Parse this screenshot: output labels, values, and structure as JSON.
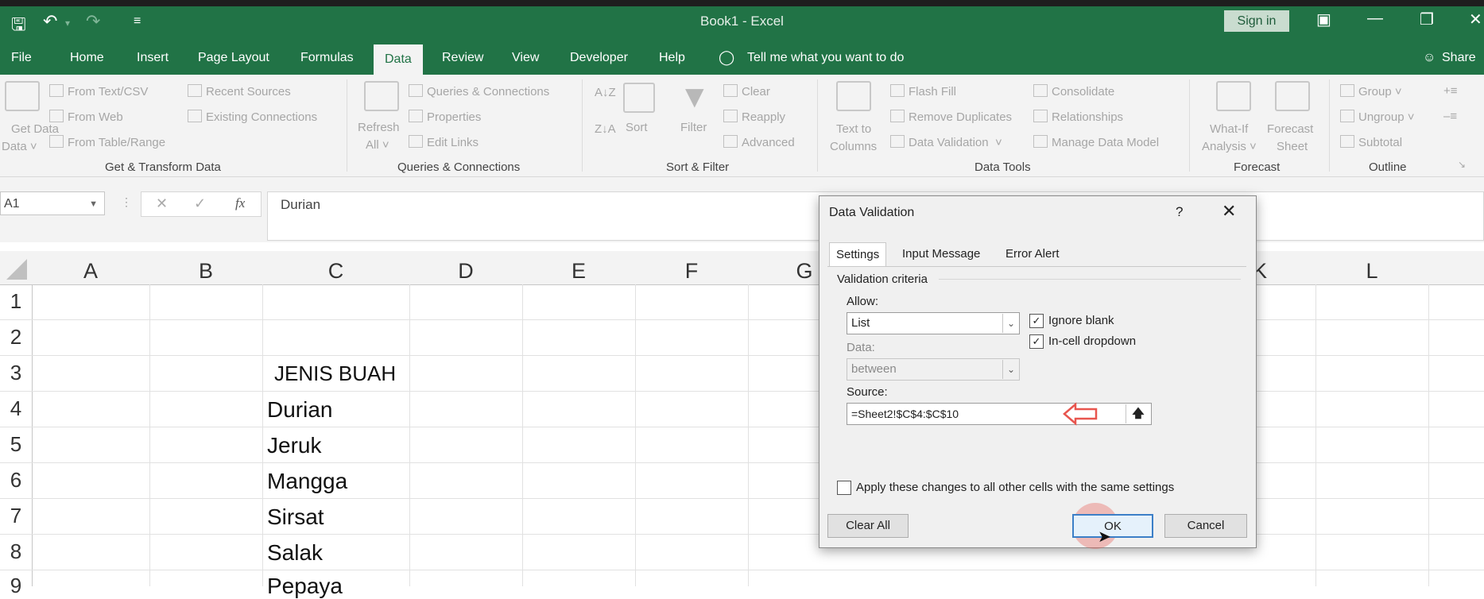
{
  "window": {
    "title": "Book1  -  Excel",
    "sign_in": "Sign in",
    "share": "Share"
  },
  "tabs": [
    "File",
    "Home",
    "Insert",
    "Page Layout",
    "Formulas",
    "Data",
    "Review",
    "View",
    "Developer",
    "Help"
  ],
  "tell_me": "Tell me what you want to do",
  "ribbon": {
    "get_data": "Get Data",
    "get_data_arrow": "Data ˅",
    "from_text_csv": "From Text/CSV",
    "from_web": "From Web",
    "from_table_range": "From Table/Range",
    "recent_sources": "Recent Sources",
    "existing_connections": "Existing Connections",
    "group_get_transform": "Get & Transform Data",
    "refresh_all": "Refresh",
    "refresh_all_2": "All ˅",
    "queries_connections": "Queries & Connections",
    "properties": "Properties",
    "edit_links": "Edit Links",
    "group_queries": "Queries & Connections",
    "sort": "Sort",
    "filter": "Filter",
    "clear": "Clear",
    "reapply": "Reapply",
    "advanced": "Advanced",
    "group_sort_filter": "Sort & Filter",
    "text_to_columns": "Text to",
    "text_to_columns_2": "Columns",
    "flash_fill": "Flash Fill",
    "remove_duplicates": "Remove Duplicates",
    "data_validation": "Data Validation",
    "consolidate": "Consolidate",
    "relationships": "Relationships",
    "manage_data_model": "Manage Data Model",
    "group_data_tools": "Data Tools",
    "what_if": "What-If",
    "what_if_2": "Analysis ˅",
    "forecast_sheet": "Forecast",
    "forecast_sheet_2": "Sheet",
    "group_forecast": "Forecast",
    "group_btn": "Group",
    "ungroup": "Ungroup",
    "subtotal": "Subtotal",
    "group_outline": "Outline"
  },
  "formula_bar": {
    "name_box": "A1",
    "fx": "fx",
    "value": "Durian"
  },
  "columns": [
    "A",
    "B",
    "C",
    "D",
    "E",
    "F",
    "G",
    "K",
    "L"
  ],
  "rows": [
    "1",
    "2",
    "3",
    "4",
    "5",
    "6",
    "7",
    "8",
    "9"
  ],
  "cells": {
    "c3": "JENIS BUAH",
    "c4": "Durian",
    "c5": "Jeruk",
    "c6": "Mangga",
    "c7": "Sirsat",
    "c8": "Salak",
    "c9": "Pepaya"
  },
  "dialog": {
    "title": "Data Validation",
    "help": "?",
    "tabs": [
      "Settings",
      "Input Message",
      "Error Alert"
    ],
    "section": "Validation criteria",
    "allow_label": "Allow:",
    "allow_value": "List",
    "data_label": "Data:",
    "data_value": "between",
    "ignore_blank": "Ignore blank",
    "in_cell_dropdown": "In-cell dropdown",
    "source_label": "Source:",
    "source_value": "=Sheet2!$C$4:$C$10",
    "apply_all": "Apply these changes to all other cells with the same settings",
    "clear_all": "Clear All",
    "ok": "OK",
    "cancel": "Cancel"
  },
  "colors": {
    "excel_green": "#217346",
    "annotation_red": "#e8554e"
  }
}
